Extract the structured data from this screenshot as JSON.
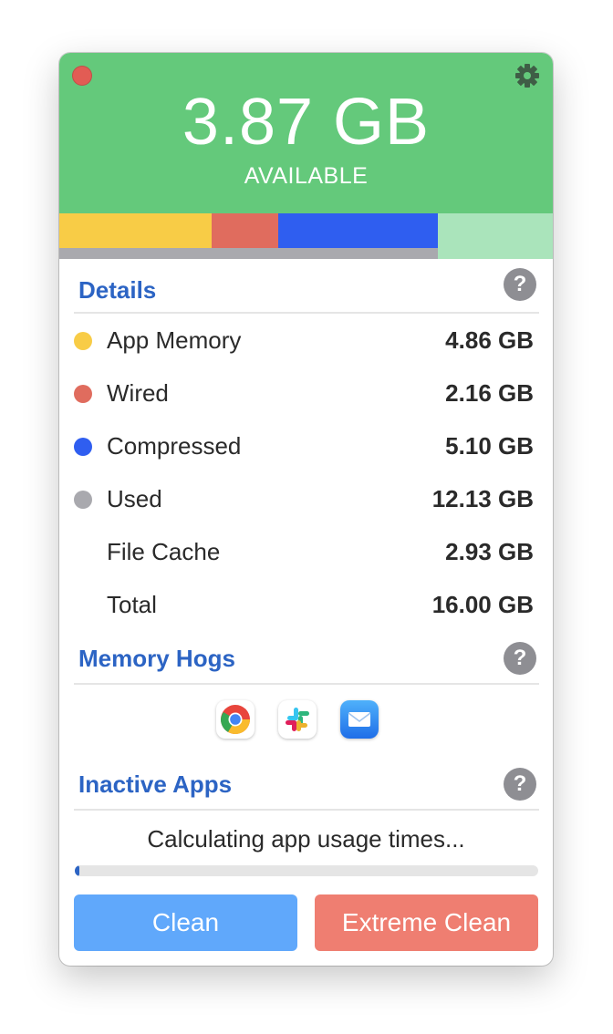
{
  "header": {
    "available_value": "3.87 GB",
    "available_label": "AVAILABLE",
    "colors": {
      "background": "#64c97b",
      "app_memory": "#f8cc46",
      "wired": "#e06c5e",
      "compressed": "#2f5ef0",
      "used": "#a9a9ae",
      "free": "#aae4bb"
    }
  },
  "details": {
    "title": "Details",
    "help_label": "?",
    "rows": [
      {
        "label": "App Memory",
        "value": "4.86 GB",
        "dot_color": "#f8cc46"
      },
      {
        "label": "Wired",
        "value": "2.16 GB",
        "dot_color": "#e06c5e"
      },
      {
        "label": "Compressed",
        "value": "5.10 GB",
        "dot_color": "#2f5ef0"
      },
      {
        "label": "Used",
        "value": "12.13 GB",
        "dot_color": "#a9a9ae"
      },
      {
        "label": "File Cache",
        "value": "2.93 GB"
      },
      {
        "label": "Total",
        "value": "16.00 GB"
      }
    ]
  },
  "memory_hogs": {
    "title": "Memory Hogs",
    "help_label": "?",
    "apps": [
      {
        "icon": "chrome-icon"
      },
      {
        "icon": "slack-icon"
      },
      {
        "icon": "mail-icon"
      }
    ]
  },
  "inactive_apps": {
    "title": "Inactive Apps",
    "help_label": "?",
    "status": "Calculating app usage times...",
    "progress": 0.01
  },
  "buttons": {
    "clean": "Clean",
    "extreme_clean": "Extreme Clean"
  }
}
